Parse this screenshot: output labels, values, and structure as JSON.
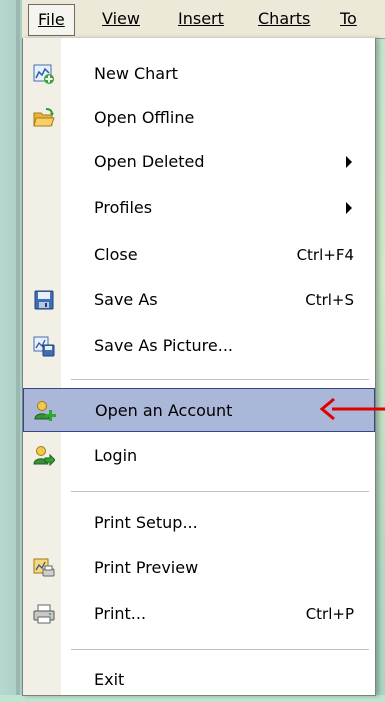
{
  "menubar": [
    {
      "label": "File",
      "mnemonic_index": 0
    },
    {
      "label": "View",
      "mnemonic_index": 0
    },
    {
      "label": "Insert",
      "mnemonic_index": 0
    },
    {
      "label": "Charts",
      "mnemonic_index": 0
    },
    {
      "label": "To",
      "mnemonic_index": 0
    }
  ],
  "menu_items": [
    {
      "label": "New Chart",
      "shortcut": "",
      "submenu": false,
      "icon": "new-chart-icon"
    },
    {
      "label": "Open Offline",
      "shortcut": "",
      "submenu": false,
      "icon": "open-folder-icon"
    },
    {
      "label": "Open Deleted",
      "shortcut": "",
      "submenu": true,
      "icon": ""
    },
    {
      "label": "Profiles",
      "shortcut": "",
      "submenu": true,
      "icon": ""
    },
    {
      "label": "Close",
      "shortcut": "Ctrl+F4",
      "submenu": false,
      "icon": ""
    },
    {
      "label": "Save As",
      "shortcut": "Ctrl+S",
      "submenu": false,
      "icon": "floppy-disk-icon"
    },
    {
      "label": "Save As Picture...",
      "shortcut": "",
      "submenu": false,
      "icon": "save-picture-icon"
    },
    {
      "label": "Open an Account",
      "shortcut": "",
      "submenu": false,
      "icon": "add-user-icon",
      "highlighted": true
    },
    {
      "label": "Login",
      "shortcut": "",
      "submenu": false,
      "icon": "login-user-icon"
    },
    {
      "label": "Print Setup...",
      "shortcut": "",
      "submenu": false,
      "icon": ""
    },
    {
      "label": "Print Preview",
      "shortcut": "",
      "submenu": false,
      "icon": "print-preview-icon"
    },
    {
      "label": "Print...",
      "shortcut": "Ctrl+P",
      "submenu": false,
      "icon": "printer-icon"
    },
    {
      "label": "Exit",
      "shortcut": "",
      "submenu": false,
      "icon": ""
    }
  ],
  "annotation": {
    "arrow_color": "#e00000",
    "icon": "red-arrow-icon"
  },
  "colors": {
    "highlight": "#aab7d8",
    "highlight_border": "#35478b",
    "menubar": "#ece9d8"
  }
}
